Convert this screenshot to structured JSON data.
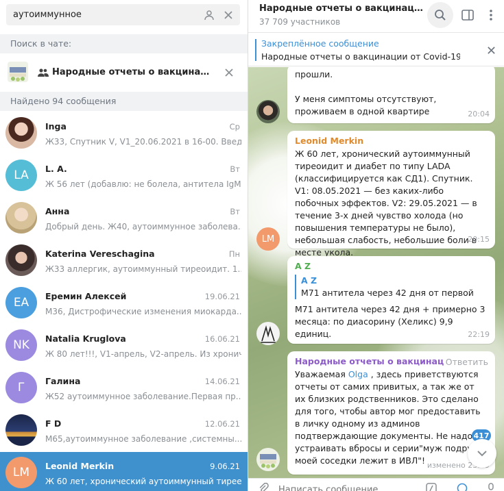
{
  "search": {
    "value": "аутоиммунное"
  },
  "sections": {
    "in_chat": "Поиск в чате:",
    "found": "Найдено 94 сообщения"
  },
  "chat": {
    "title": "Народные отчеты о вакцинации ..."
  },
  "results": [
    {
      "name": "Inga",
      "date": "Ср",
      "snippet": "Ж33, Спутник V, V1_20.06.2021 в 16-00. Введе...",
      "avatar_color": "#c48b6e",
      "initials": ""
    },
    {
      "name": "L. A.",
      "date": "Вт",
      "snippet": "Ж 56 лет (добавлю: не болела, антитела IgM ...",
      "avatar_color": "#56bdd7",
      "initials": "LA"
    },
    {
      "name": "Анна",
      "date": "Вт",
      "snippet": "Добрый день. Ж40, аутоиммунное заболева...",
      "avatar_color": "#d8c29a",
      "initials": ""
    },
    {
      "name": "Katerina Vereschagina",
      "date": "Пн",
      "snippet": "Ж33 аллергик, аутоиммунный тиреоидит. 1...",
      "avatar_color": "#3a2c2a",
      "initials": ""
    },
    {
      "name": "Еремин Алексей",
      "date": "19.06.21",
      "snippet": "M36, Дистрофические изменения миокарда...",
      "avatar_color": "#4b9fde",
      "initials": "EA"
    },
    {
      "name": "Natalia Kruglova",
      "date": "16.06.21",
      "snippet": "Ж 80 лет!!!, V1-апрель, V2-апрель. Из хронич...",
      "avatar_color": "#9b8ae0",
      "initials": "NK"
    },
    {
      "name": "Галина",
      "date": "14.06.21",
      "snippet": "Ж52 аутоиммунное заболевание.Первая пр...",
      "avatar_color": "#9b8ae0",
      "initials": "Г"
    },
    {
      "name": "F D",
      "date": "12.06.21",
      "snippet": "M65,аутоиммунное заболевание ,системны...",
      "avatar_color": "#22305a",
      "initials": ""
    },
    {
      "name": "Leonid Merkin",
      "date": "9.06.21",
      "snippet": "Ж 60 лет, хронический аутоиммунный тирее...",
      "avatar_color": "#f29a6c",
      "initials": "LM"
    }
  ],
  "header": {
    "title": "Народные отчеты о вакцинации о...",
    "subtitle": "37 709 участников"
  },
  "pinned": {
    "label": "Закреплённое сообщение",
    "text": "Народные отчеты о вакцинации от Covid-19 ..."
  },
  "messages": [
    {
      "text": "прошли.\n\nУ меня симптомы отсутствуют, проживаем в одной квартире",
      "time": "20:04"
    },
    {
      "sender": "Leonid Merkin",
      "sender_color": "#e08a2c",
      "text": "Ж 60 лет, хронический аутоиммунный тиреоидит и диабет по типу LADA (классифицируется как СД1). Спутник. V1: 08.05.2021 — без каких-либо побочных эффектов. V2: 29.05.2021 — в течение 3-х дней чувство холода (но повышения температуры не было), небольшая слабость, небольшие боли в месте укола.",
      "time": "20:15",
      "initials": "LM",
      "avatar_color": "#f29a6c"
    },
    {
      "sender": "A Z",
      "sender_color": "#4fae4e",
      "quote_name": "A Z",
      "quote_text": "M71 антитела через 42 дня от первой при...",
      "text": "M71 антитела через 42 дня + примерно 3 месяца: по диасорину (Хеликс) 9,9 единиц.",
      "time": "22:19"
    },
    {
      "sender": "Народные отчеты о вакцинац...",
      "sender_color": "#8c5bc8",
      "reply": "Ответить",
      "text_before": "Уважаемая ",
      "mention": "Olga",
      "text_after": " , здесь приветствуются отчеты от самих привитых, а так же от их близких родственников. Это сделано для того, чтобы автор мог предоставить в личку одному из админов подтверждающие документы. Не надо устраивать вбросы и серии\"муж подруги моей соседки лежит в ИВЛ\"!",
      "time": "изменено 23:09"
    }
  ],
  "unread_badge": "417",
  "composer": {
    "placeholder": "Написать сообщение..."
  }
}
